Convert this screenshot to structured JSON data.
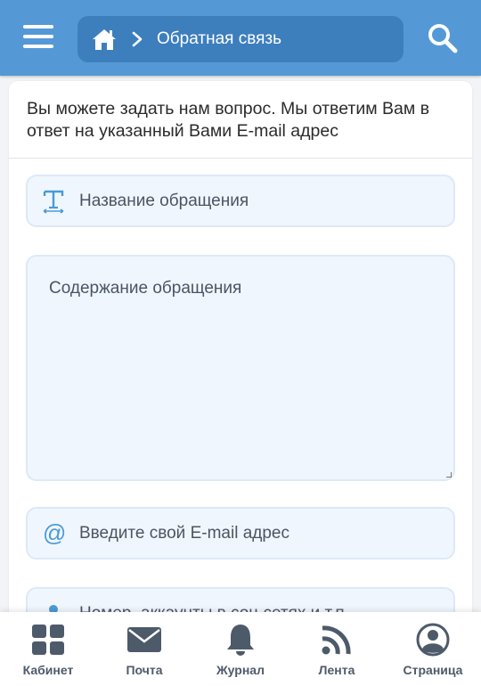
{
  "header": {
    "breadcrumb_title": "Обратная связь"
  },
  "intro_text": "Вы можете задать нам вопрос. Мы ответим Вам в ответ на указанный Вами E-mail адрес",
  "form": {
    "title_placeholder": "Название обращения",
    "body_placeholder": "Содержание обращения",
    "email_placeholder": "Введите свой E-mail адрес",
    "social_placeholder": "Номер, аккаунты в соц.сетях и т.п."
  },
  "bottom_nav": {
    "cabinet": "Кабинет",
    "mail": "Почта",
    "journal": "Журнал",
    "feed": "Лента",
    "page": "Страница"
  },
  "colors": {
    "header_bg": "#5499d6",
    "breadcrumb_bg": "#3d7fbd",
    "icon_accent": "#4a9ad6",
    "nav_icon": "#4d5a6a"
  }
}
